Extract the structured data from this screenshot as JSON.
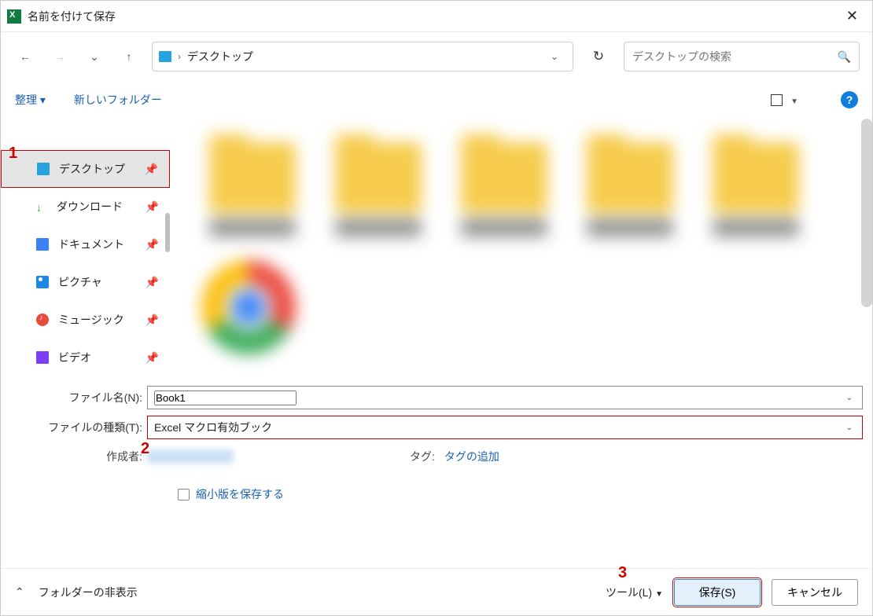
{
  "titlebar": {
    "title": "名前を付けて保存"
  },
  "address": {
    "crumb": "デスクトップ"
  },
  "search": {
    "placeholder": "デスクトップの検索"
  },
  "toolrow": {
    "organize": "整理",
    "newfolder": "新しいフォルダー"
  },
  "sidebar": {
    "items": [
      {
        "label": "デスクトップ"
      },
      {
        "label": "ダウンロード"
      },
      {
        "label": "ドキュメント"
      },
      {
        "label": "ピクチャ"
      },
      {
        "label": "ミュージック"
      },
      {
        "label": "ビデオ"
      }
    ]
  },
  "filename": {
    "label": "ファイル名(N):",
    "value": "Book1"
  },
  "filetype": {
    "label": "ファイルの種類(T):",
    "value": "Excel マクロ有効ブック"
  },
  "meta": {
    "author_label": "作成者:",
    "tag_label": "タグ:",
    "tag_action": "タグの追加"
  },
  "thumb": {
    "label": "縮小版を保存する"
  },
  "footer": {
    "hide_folders": "フォルダーの非表示",
    "tool": "ツール(L)",
    "save": "保存(S)",
    "cancel": "キャンセル"
  },
  "annotations": {
    "a1": "1",
    "a2": "2",
    "a3": "3"
  }
}
